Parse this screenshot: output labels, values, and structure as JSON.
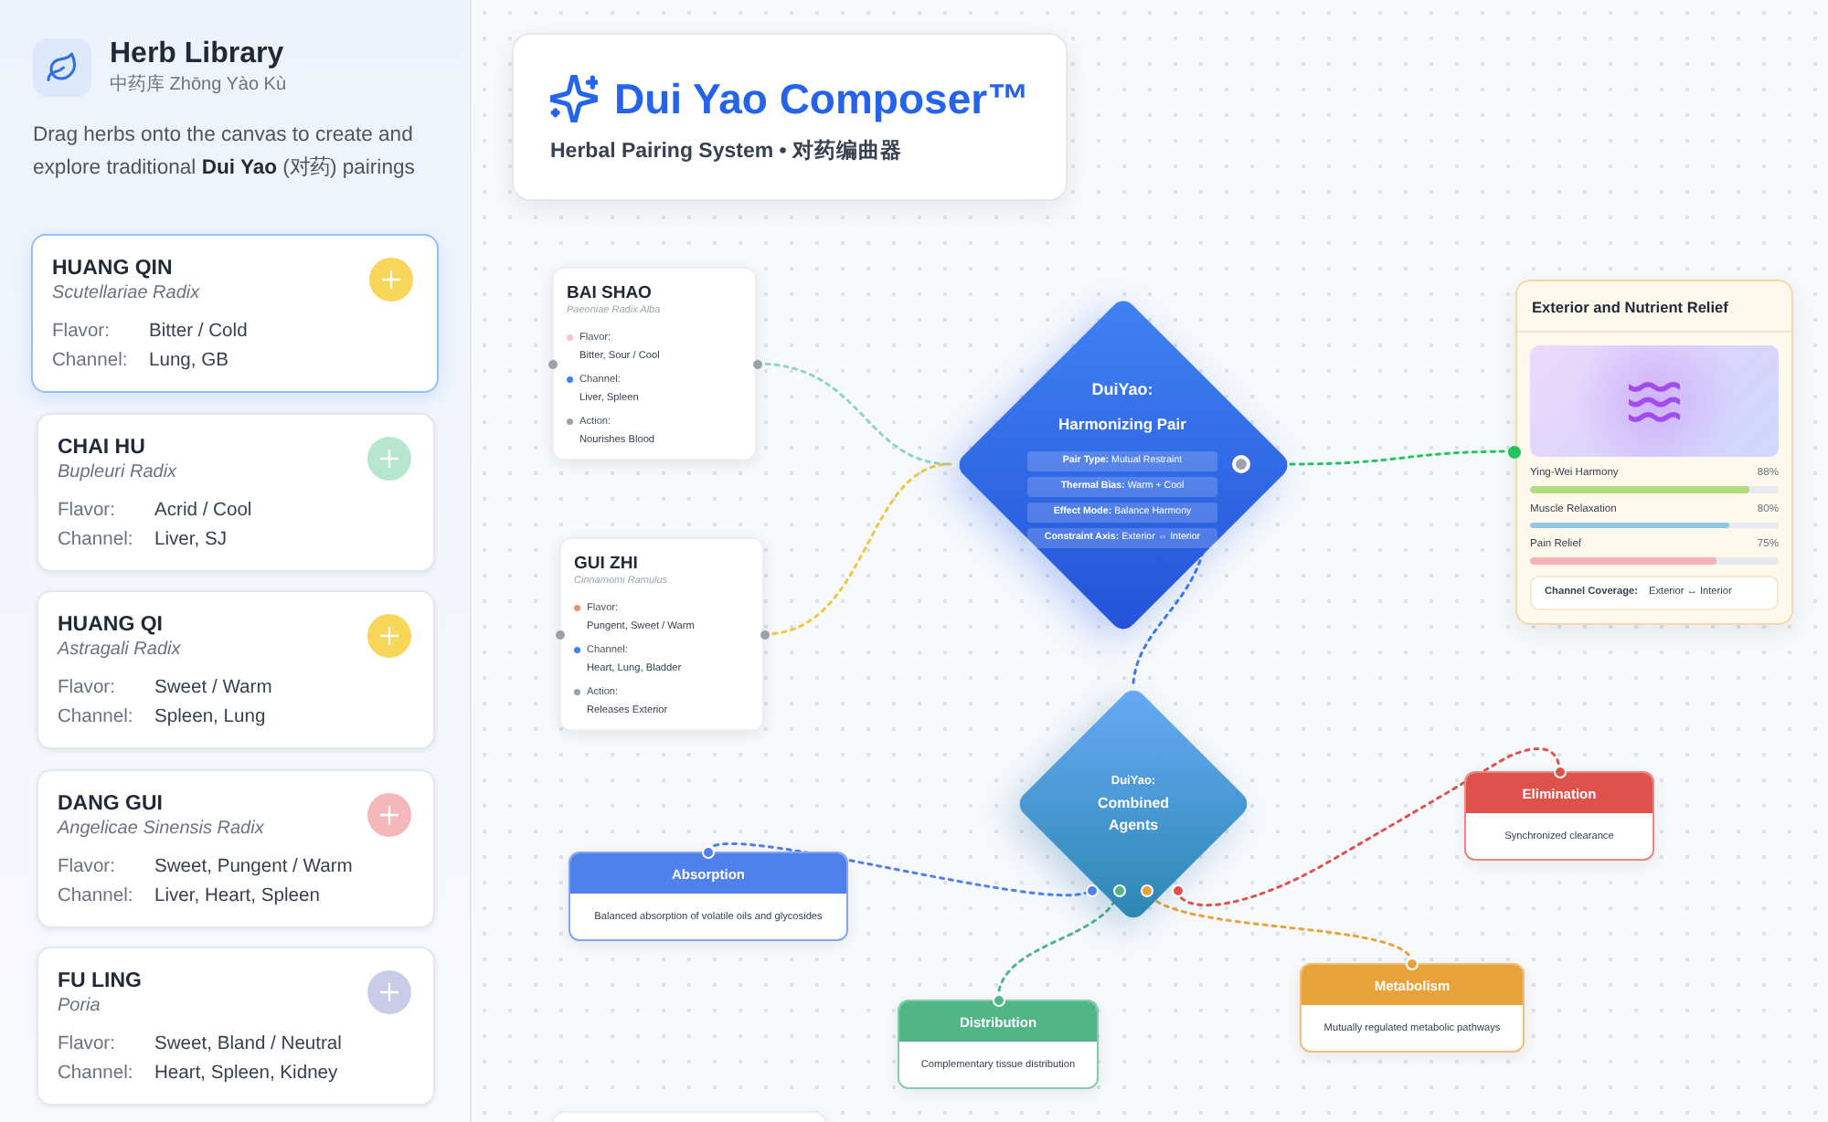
{
  "sidebar": {
    "title": "Herb Library",
    "subtitle": "中药库 Zhōng Yào Kù",
    "description": "Drag herbs onto the canvas to create and explore traditional **Dui Yao** (对药) pairings",
    "herbs": [
      {
        "name": "HUANG QIN",
        "latin": "Scutellariae Radix",
        "properties": [
          {
            "label": "Flavor:",
            "value": "Bitter / Cold"
          },
          {
            "label": "Channel:",
            "value": "Lung, GB"
          }
        ],
        "color": "#f7d65a",
        "selected": true
      },
      {
        "name": "CHAI HU",
        "latin": "Bupleuri Radix",
        "properties": [
          {
            "label": "Flavor:",
            "value": "Acrid / Cool"
          },
          {
            "label": "Channel:",
            "value": "Liver, SJ"
          }
        ],
        "color": "#b7e6cf",
        "selected": false
      },
      {
        "name": "HUANG QI",
        "latin": "Astragali Radix",
        "properties": [
          {
            "label": "Flavor:",
            "value": "Sweet / Warm"
          },
          {
            "label": "Channel:",
            "value": "Spleen, Lung"
          }
        ],
        "color": "#f7d65a",
        "selected": false
      },
      {
        "name": "DANG GUI",
        "latin": "Angelicae Sinensis Radix",
        "properties": [
          {
            "label": "Flavor:",
            "value": "Sweet, Pungent / Warm"
          },
          {
            "label": "Channel:",
            "value": "Liver, Heart, Spleen"
          }
        ],
        "color": "#f4b8bb",
        "selected": false
      },
      {
        "name": "FU LING",
        "latin": "Poria",
        "properties": [
          {
            "label": "Flavor:",
            "value": "Sweet, Bland / Neutral"
          },
          {
            "label": "Channel:",
            "value": "Heart, Spleen, Kidney"
          }
        ],
        "color": "#c9cce9",
        "selected": false
      }
    ]
  },
  "header": {
    "title": "Dui Yao Composer™",
    "subtitle": "Herbal Pairing System • 对药编曲器"
  },
  "canvas": {
    "herb_nodes": [
      {
        "name": "BAI SHAO",
        "latin": "Paeoniae Radix Alba",
        "properties": [
          {
            "label": "Flavor:",
            "value": "Bitter, Sour / Cool",
            "color": "#f7c5d0"
          },
          {
            "label": "Channel:",
            "value": "Liver, Spleen",
            "color": "#3b82f6"
          },
          {
            "label": "Action:",
            "value": "Nourishes Blood",
            "color": "#9ca3af"
          }
        ]
      },
      {
        "name": "GUI ZHI",
        "latin": "Cinnamomi Ramulus",
        "properties": [
          {
            "label": "Flavor:",
            "value": "Pungent, Sweet / Warm",
            "color": "#f4916a"
          },
          {
            "label": "Channel:",
            "value": "Heart, Lung, Bladder",
            "color": "#3b82f6"
          },
          {
            "label": "Action:",
            "value": "Releases Exterior",
            "color": "#9ca3af"
          }
        ]
      }
    ],
    "pair_node": {
      "title": "DuiYao:",
      "subtitle": "Harmonizing Pair",
      "tags": [
        "**Pair Type:** Mutual Restraint",
        "**Thermal Bias:** Warm + Cool",
        "**Effect Mode:** Balance Harmony",
        "**Constraint Axis:** Exterior ⇔ Interior"
      ]
    },
    "effect_card": {
      "title": "Exterior and Nutrient Relief",
      "metrics": [
        {
          "label": "Ying-Wei Harmony",
          "reading": "88%",
          "level": 0.88,
          "color": "#b0dc7e"
        },
        {
          "label": "Muscle Relaxation",
          "reading": "80%",
          "level": 0.8,
          "color": "#90c6e0"
        },
        {
          "label": "Pain Relief",
          "reading": "75%",
          "level": 0.75,
          "color": "#f6b3b7"
        }
      ],
      "coverage_label": "Channel Coverage:",
      "coverage_value": "Exterior ↔ Interior"
    },
    "agents_node": {
      "title": "DuiYao:",
      "subtitle": "Combined Agents"
    },
    "stage_nodes": [
      {
        "title": "Absorption",
        "description": "Balanced absorption of volatile oils and glycosides",
        "color": "#4f80ec"
      },
      {
        "title": "Distribution",
        "description": "Complementary tissue distribution",
        "color": "#52b585"
      },
      {
        "title": "Metabolism",
        "description": "Mutually regulated metabolic pathways",
        "color": "#e9a23b"
      },
      {
        "title": "Elimination",
        "description": "Synchronized clearance",
        "color": "#de524b"
      }
    ]
  }
}
